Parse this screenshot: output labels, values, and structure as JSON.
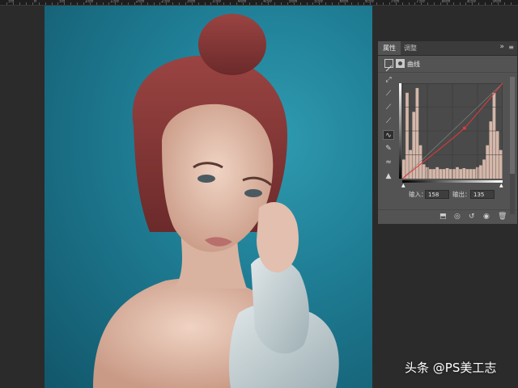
{
  "ruler": {
    "labels": [
      "50",
      "0",
      "50",
      "100",
      "150",
      "200",
      "250",
      "300",
      "350",
      "400",
      "450",
      "500",
      "550",
      "600",
      "650",
      "700",
      "750",
      "800",
      "850",
      "900"
    ]
  },
  "photo": {
    "description_icon": "portrait-photo",
    "colors": {
      "background": "#1f7e95",
      "hair": "#8a3a38",
      "skin": "#e7c6b4",
      "sweater": "#c9d3d6"
    }
  },
  "panel": {
    "tabs": [
      {
        "label": "属性",
        "active": true
      },
      {
        "label": "调整",
        "active": false
      }
    ],
    "collapse_icon": "double-chevron-icon",
    "menu_icon": "panel-menu-icon",
    "type_label": "曲线",
    "tools": [
      {
        "name": "target-adjust-icon",
        "glyph": "⤢"
      },
      {
        "name": "eyedropper-black-icon",
        "glyph": "⟋"
      },
      {
        "name": "eyedropper-gray-icon",
        "glyph": "⟋"
      },
      {
        "name": "eyedropper-white-icon",
        "glyph": "⟋"
      },
      {
        "name": "curve-points-icon",
        "glyph": "∿",
        "active": true
      },
      {
        "name": "pencil-icon",
        "glyph": "✎"
      },
      {
        "name": "smooth-icon",
        "glyph": "≈"
      },
      {
        "name": "clipping-warning-icon",
        "glyph": "▲"
      }
    ],
    "input_label": "输入：",
    "input_value": "158",
    "output_label": "输出：",
    "output_value": "135",
    "footer_icons": [
      "clip-to-layer-icon",
      "view-previous-icon",
      "reset-icon",
      "visibility-eye-icon",
      "trash-icon"
    ],
    "colors": {
      "curve": "#e03a3a",
      "histogram": "#d4b7a9",
      "panel_bg": "#535353"
    }
  },
  "watermark": {
    "text": "头条 @PS美工志"
  }
}
